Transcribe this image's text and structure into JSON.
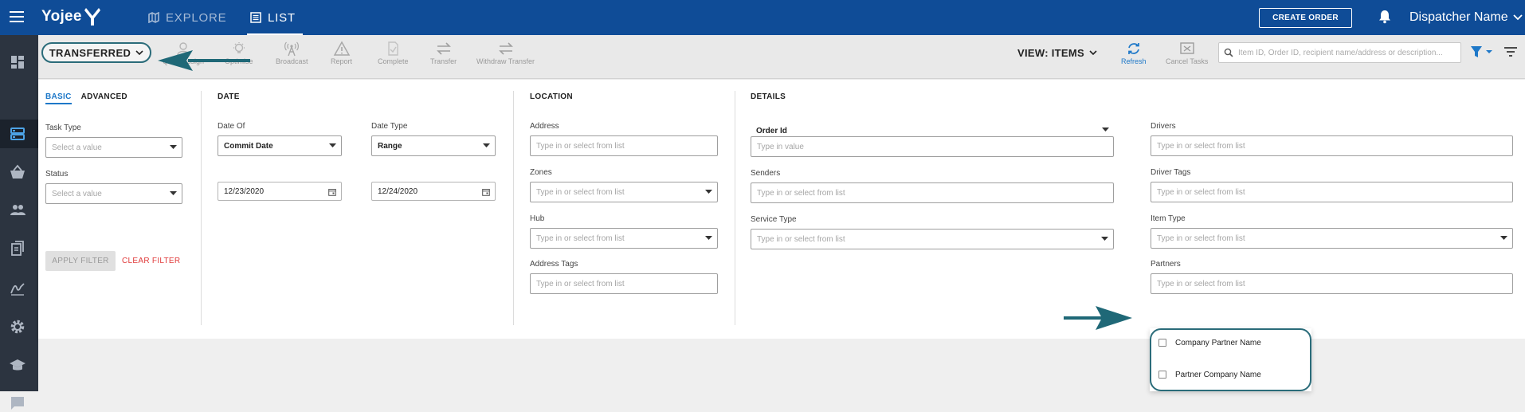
{
  "header": {
    "logo_text": "Yojee",
    "nav": {
      "explore": "EXPLORE",
      "list": "LIST"
    },
    "create_order": "CREATE ORDER",
    "user_name": "Dispatcher Name"
  },
  "sidebar": {
    "items": [
      "dashboard-icon",
      "list-view-icon",
      "basket-icon",
      "people-icon",
      "documents-icon",
      "signature-icon",
      "settings-icon",
      "school-icon",
      "chat-icon"
    ]
  },
  "toolbar": {
    "status_filter": "TRANSFERRED",
    "actions": [
      "Quick Assign",
      "Optimise",
      "Broadcast",
      "Report",
      "Complete",
      "Transfer",
      "Withdraw Transfer"
    ],
    "view_label": "VIEW: ITEMS",
    "refresh": "Refresh",
    "cancel_tasks": "Cancel Tasks",
    "search_placeholder": "Item ID, Order ID, recipient name/address or description..."
  },
  "filter": {
    "tabs": [
      "BASIC",
      "ADVANCED"
    ],
    "basic": {
      "task_type_label": "Task Type",
      "task_type_placeholder": "Select a value",
      "status_label": "Status",
      "status_placeholder": "Select a value",
      "apply": "APPLY FILTER",
      "clear": "CLEAR FILTER"
    },
    "date": {
      "title": "DATE",
      "date_of_label": "Date Of",
      "date_of_value": "Commit Date",
      "date_type_label": "Date Type",
      "date_type_value": "Range",
      "from": "12/23/2020",
      "to": "12/24/2020"
    },
    "location": {
      "title": "LOCATION",
      "address_label": "Address",
      "zones_label": "Zones",
      "hub_label": "Hub",
      "address_tags_label": "Address Tags",
      "placeholder": "Type in or select from list"
    },
    "details": {
      "title": "DETAILS",
      "order_id_label": "Order Id",
      "order_id_placeholder": "Type in value",
      "senders_label": "Senders",
      "service_type_label": "Service Type",
      "drivers_label": "Drivers",
      "driver_tags_label": "Driver Tags",
      "item_type_label": "Item Type",
      "partners_label": "Partners",
      "placeholder": "Type in or select from list",
      "partner_options": [
        "Company Partner Name",
        "Partner Company Name"
      ]
    }
  },
  "colors": {
    "brand": "#0f4c97",
    "accent": "#1e78c8",
    "annotation": "#2b6c7a",
    "danger": "#e03a3a"
  }
}
